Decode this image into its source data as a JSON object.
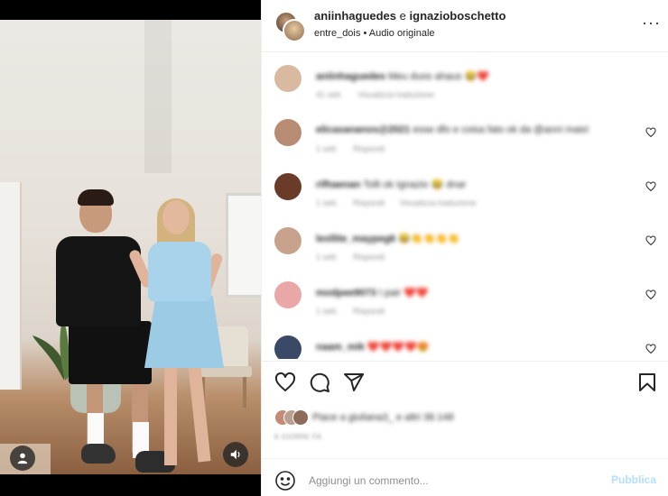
{
  "header": {
    "user1": "aniinhaguedes",
    "conjunction": "e",
    "user2": "ignazioboschetto",
    "audio_user": "entre_dois",
    "audio_separator": "•",
    "audio_label": "Audio originale"
  },
  "comments": [
    {
      "user": "aniinhaguedes",
      "text": "Meu duos ahaus 😂❤️",
      "meta": [
        "41 sett.",
        "Visualizza traduzione"
      ],
      "avatar_color": "#d9b9a0",
      "has_like": false
    },
    {
      "user": "elicasananos@2021",
      "text": "esse dfo e coisa fato ok da @anni mais!",
      "meta": [
        "1 sett.",
        "Rispondi"
      ],
      "avatar_color": "#b78c73",
      "has_like": true
    },
    {
      "user": "rifhaenan",
      "text": "Tolli ok Ignazio 😂 dnar",
      "meta": [
        "1 sett.",
        "Rispondi",
        "Visualizza traduzione"
      ],
      "avatar_color": "#6b3b2a",
      "has_like": true
    },
    {
      "user": "lesllite_maypeg6",
      "text": "😂👏👏👏👏",
      "meta": [
        "1 sett.",
        "Rispondi"
      ],
      "avatar_color": "#c9a28e",
      "has_like": true
    },
    {
      "user": "modpee9073",
      "text": "I pair ❤️❤️",
      "meta": [
        "1 sett.",
        "Rispondi"
      ],
      "avatar_color": "#e9a7a7",
      "has_like": true
    },
    {
      "user": "naam_mik",
      "text": "❤️❤️❤️❤️😍",
      "meta": [],
      "avatar_color": "#3a4a66",
      "has_like": true
    }
  ],
  "actions": {
    "like_icon": "heart-icon",
    "comment_icon": "comment-icon",
    "share_icon": "send-icon",
    "save_icon": "bookmark-icon"
  },
  "likes": {
    "text": "Piace a giuliana3_ e altri 38.148"
  },
  "timestamp": "6 GIORNI FA",
  "add_comment": {
    "placeholder": "Aggiungi un commento...",
    "post_label": "Pubblica",
    "post_color": "#b2dffc"
  }
}
